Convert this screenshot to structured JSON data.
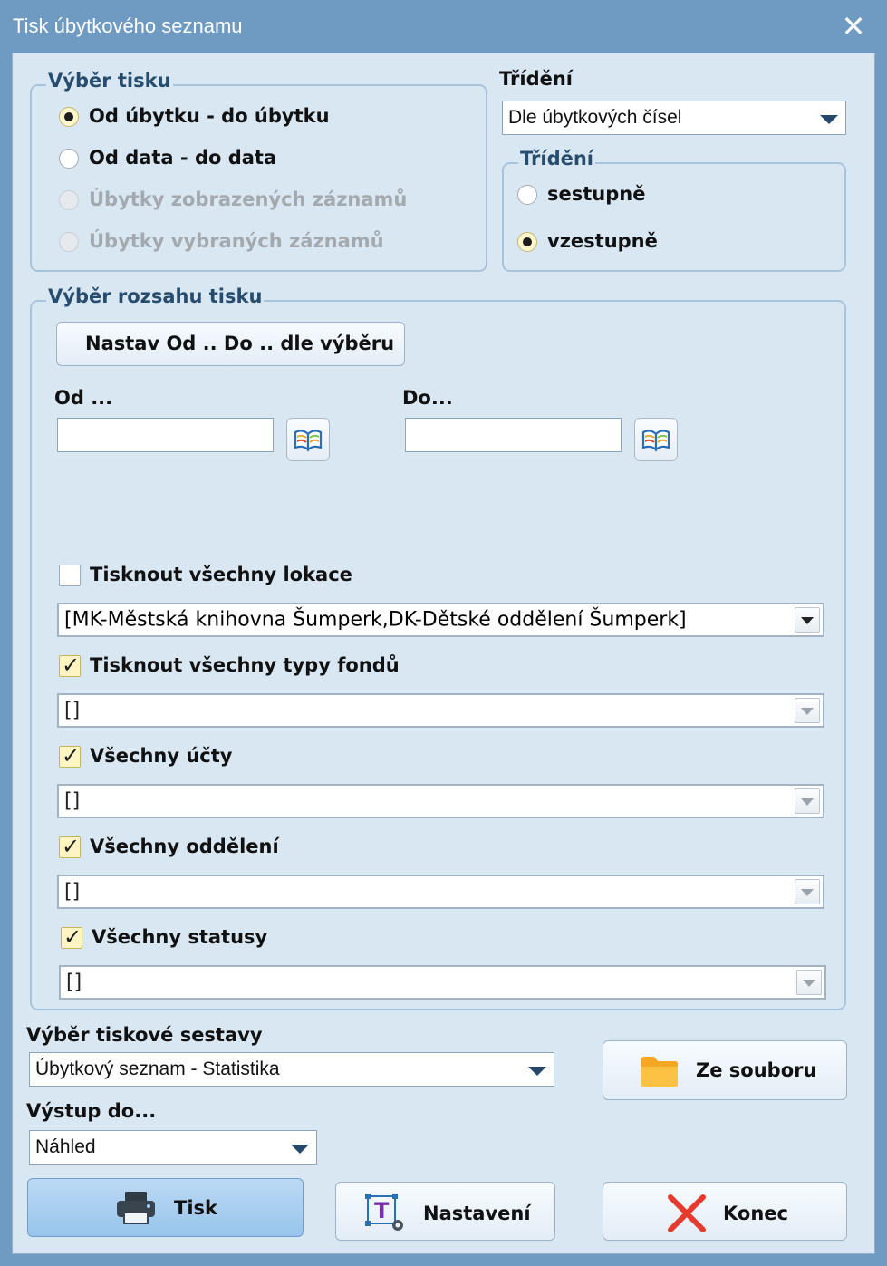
{
  "window": {
    "title": "Tisk úbytkového seznamu",
    "close_glyph": "✕"
  },
  "print_selection": {
    "legend": "Výběr tisku",
    "options": [
      {
        "label": "Od úbytku - do úbytku",
        "checked": true,
        "enabled": true
      },
      {
        "label": "Od data - do data",
        "checked": false,
        "enabled": true
      },
      {
        "label": "Úbytky zobrazených záznamů",
        "checked": false,
        "enabled": false
      },
      {
        "label": "Úbytky vybraných záznamů",
        "checked": false,
        "enabled": false
      }
    ]
  },
  "sorting": {
    "label": "Třídění",
    "combo_value": "Dle úbytkových čísel",
    "group_legend": "Třídění",
    "options": [
      {
        "label": "sestupně",
        "checked": false
      },
      {
        "label": "vzestupně",
        "checked": true
      }
    ]
  },
  "range": {
    "legend": "Výběr rozsahu tisku",
    "set_button": "Nastav  Od .. Do .. dle výběru",
    "from_label": "Od ...",
    "to_label": "Do...",
    "from_value": "",
    "to_value": "",
    "book_icon": "book-icon"
  },
  "filters": [
    {
      "label": "Tisknout všechny lokace",
      "checked": false,
      "combo_value": "[MK-Městská knihovna Šumperk,DK-Dětské oddělení Šumperk]",
      "combo_enabled": true
    },
    {
      "label": "Tisknout všechny typy fondů",
      "checked": true,
      "combo_value": "[]",
      "combo_enabled": false
    },
    {
      "label": "Všechny účty",
      "checked": true,
      "combo_value": "[]",
      "combo_enabled": false
    },
    {
      "label": "Všechny oddělení",
      "checked": true,
      "combo_value": "[]",
      "combo_enabled": false
    },
    {
      "label": "Všechny statusy",
      "checked": true,
      "combo_value": "[]",
      "combo_enabled": false
    }
  ],
  "check_glyph": "✓",
  "report": {
    "label": "Výběr tiskové sestavy",
    "value": "Úbytkový seznam - Statistika",
    "from_file_button": "Ze souboru",
    "folder_icon": "folder-icon"
  },
  "output": {
    "label": "Výstup do...",
    "value": "Náhled"
  },
  "buttons": {
    "print": "Tisk",
    "settings": "Nastavení",
    "close": "Konec"
  },
  "colors": {
    "title_bar": "#6f9bc3",
    "client_bg": "#d9e7f3",
    "legend_text": "#264c6e",
    "primary_button": "#98c4ec",
    "close_x": "#e53b2f",
    "folder": "#f6b531"
  }
}
